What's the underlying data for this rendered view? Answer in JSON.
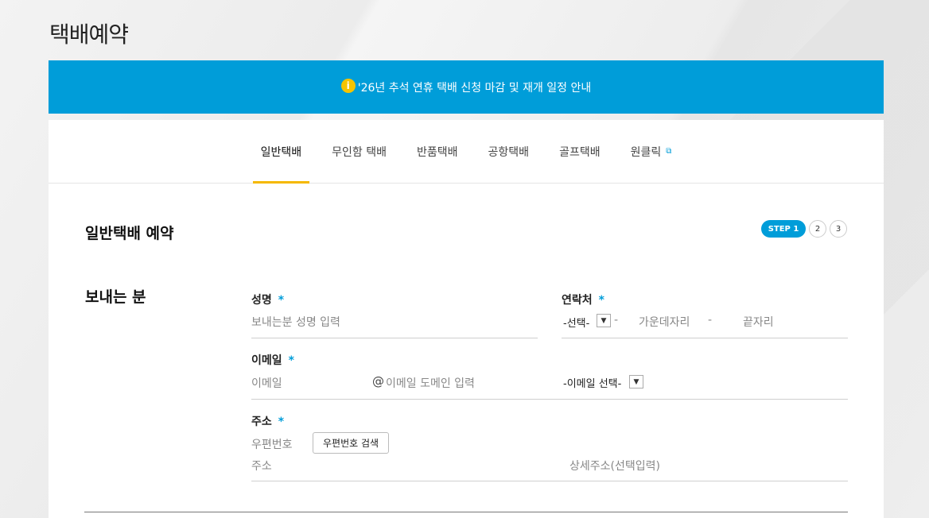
{
  "page": {
    "title": "택배예약"
  },
  "notice": {
    "icon": "info-icon",
    "icon_glyph": "i",
    "text": "'26년 추석 연휴 택배 신청 마감 및 재개 일정 안내"
  },
  "tabs": [
    {
      "label": "일반택배",
      "active": true
    },
    {
      "label": "무인함 택배",
      "active": false
    },
    {
      "label": "반품택배",
      "active": false
    },
    {
      "label": "공항택배",
      "active": false
    },
    {
      "label": "골프택배",
      "active": false
    },
    {
      "label": "원클릭",
      "active": false,
      "external_icon": "external-link-icon"
    }
  ],
  "section": {
    "title": "일반택배 예약"
  },
  "steps": {
    "active": "STEP 1",
    "others": [
      "2",
      "3"
    ]
  },
  "sender": {
    "title": "보내는 분",
    "name": {
      "label": "성명",
      "required": "*",
      "placeholder": "보내는분 성명 입력"
    },
    "phone": {
      "label": "연락처",
      "required": "*",
      "select_value": "-선택-",
      "dash": "-",
      "middle_placeholder": "가운데자리",
      "last_placeholder": "끝자리"
    },
    "email": {
      "label": "이메일",
      "required": "*",
      "id_placeholder": "이메일",
      "at": "@",
      "domain_placeholder": "이메일 도메인 입력",
      "select_value": "-이메일 선택-"
    },
    "address": {
      "label": "주소",
      "required": "*",
      "zip_placeholder": "우편번호",
      "search_button": "우편번호 검색",
      "addr_placeholder": "주소",
      "detail_placeholder": "상세주소(선택입력)"
    }
  },
  "colors": {
    "accent": "#009dd9",
    "tab_underline": "#f5b800",
    "notice_icon": "#f5c400"
  }
}
